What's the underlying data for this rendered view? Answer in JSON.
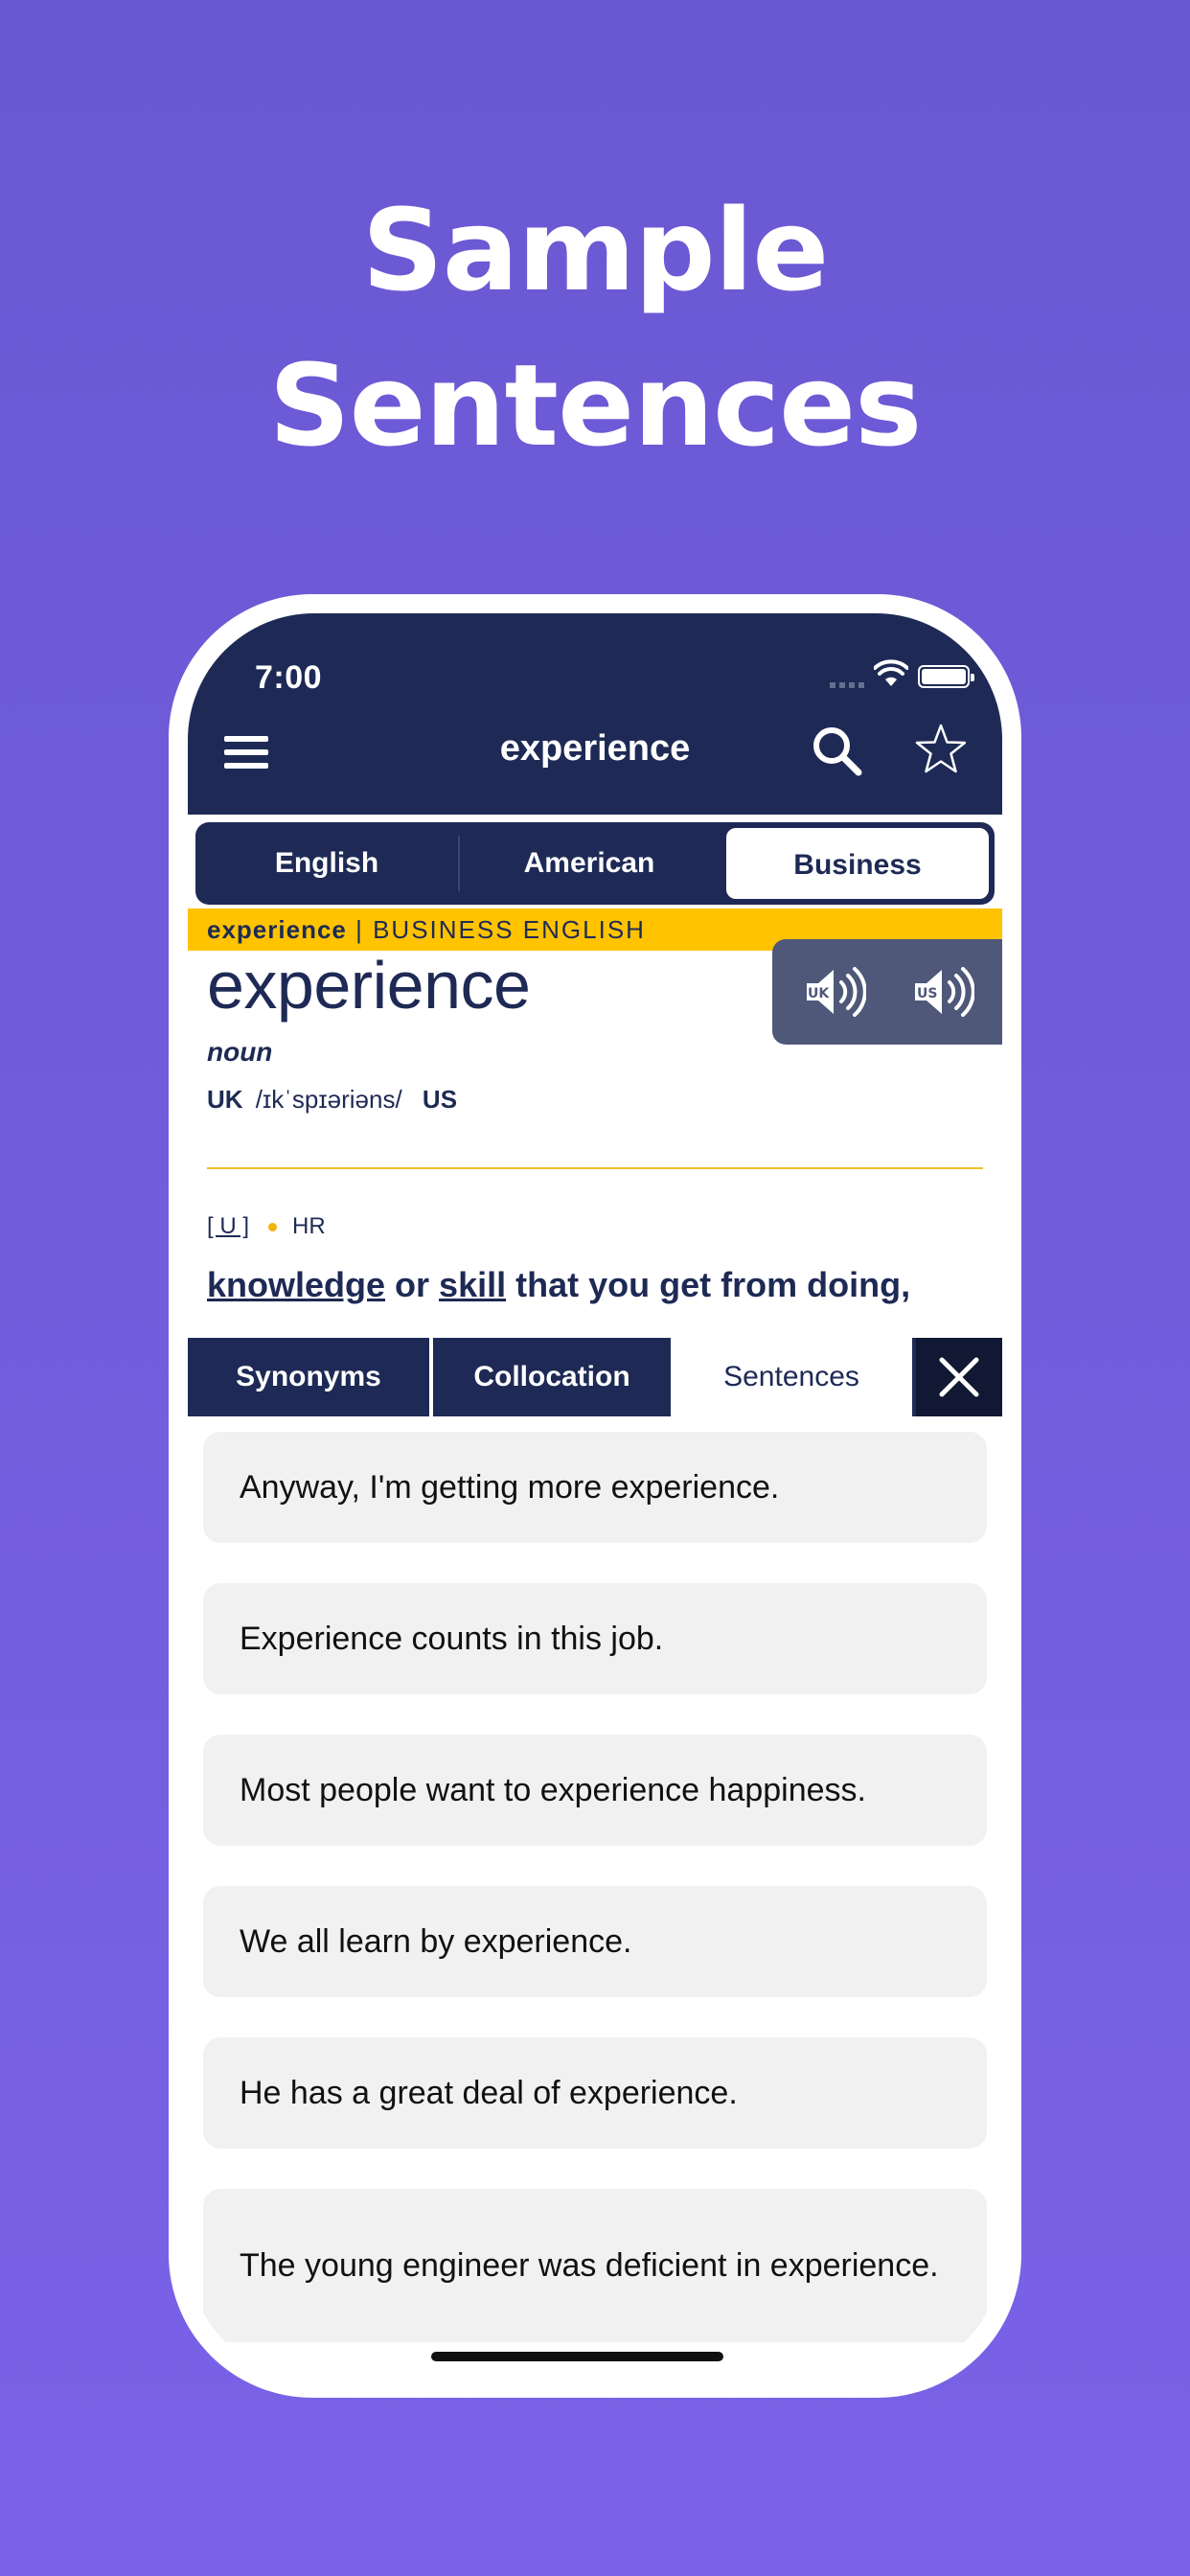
{
  "headline": {
    "line1": "Sample",
    "line2": "Sentences"
  },
  "status_bar": {
    "time": "7:00"
  },
  "nav": {
    "title": "experience",
    "icons": [
      "menu-icon",
      "search-icon",
      "star-icon"
    ]
  },
  "dictionary_tabs": [
    {
      "label": "English",
      "active": false
    },
    {
      "label": "American",
      "active": false
    },
    {
      "label": "Business",
      "active": true
    }
  ],
  "banner": {
    "word": "experience",
    "separator": " | ",
    "section": "BUSINESS ENGLISH"
  },
  "audio": {
    "uk_label": "UK",
    "us_label": "US"
  },
  "entry": {
    "headword": "experience",
    "part_of_speech": "noun",
    "uk_label": "UK",
    "uk_ipa": "/ɪkˈspɪəriəns/",
    "us_label": "US",
    "grammar": "[ U ]",
    "domain": "HR",
    "definition_link1": "knowledge",
    "definition_or": " or ",
    "definition_link2": "skill",
    "definition_rest": " that you get from doing,"
  },
  "bottom_tabs": [
    {
      "label": "Synonyms",
      "active": false
    },
    {
      "label": "Collocation",
      "active": false
    },
    {
      "label": "Sentences",
      "active": true
    }
  ],
  "sentences": [
    "Anyway, I'm getting more experience.",
    "Experience counts in this job.",
    "Most people want to experience happiness.",
    "We all learn by experience.",
    "He has a great deal of experience.",
    "The young engineer was deficient in experience."
  ],
  "colors": {
    "background": "#6a58d2",
    "navy": "#1e2a55",
    "banner_yellow": "#ffc300",
    "card_gray": "#f1f1f1"
  }
}
